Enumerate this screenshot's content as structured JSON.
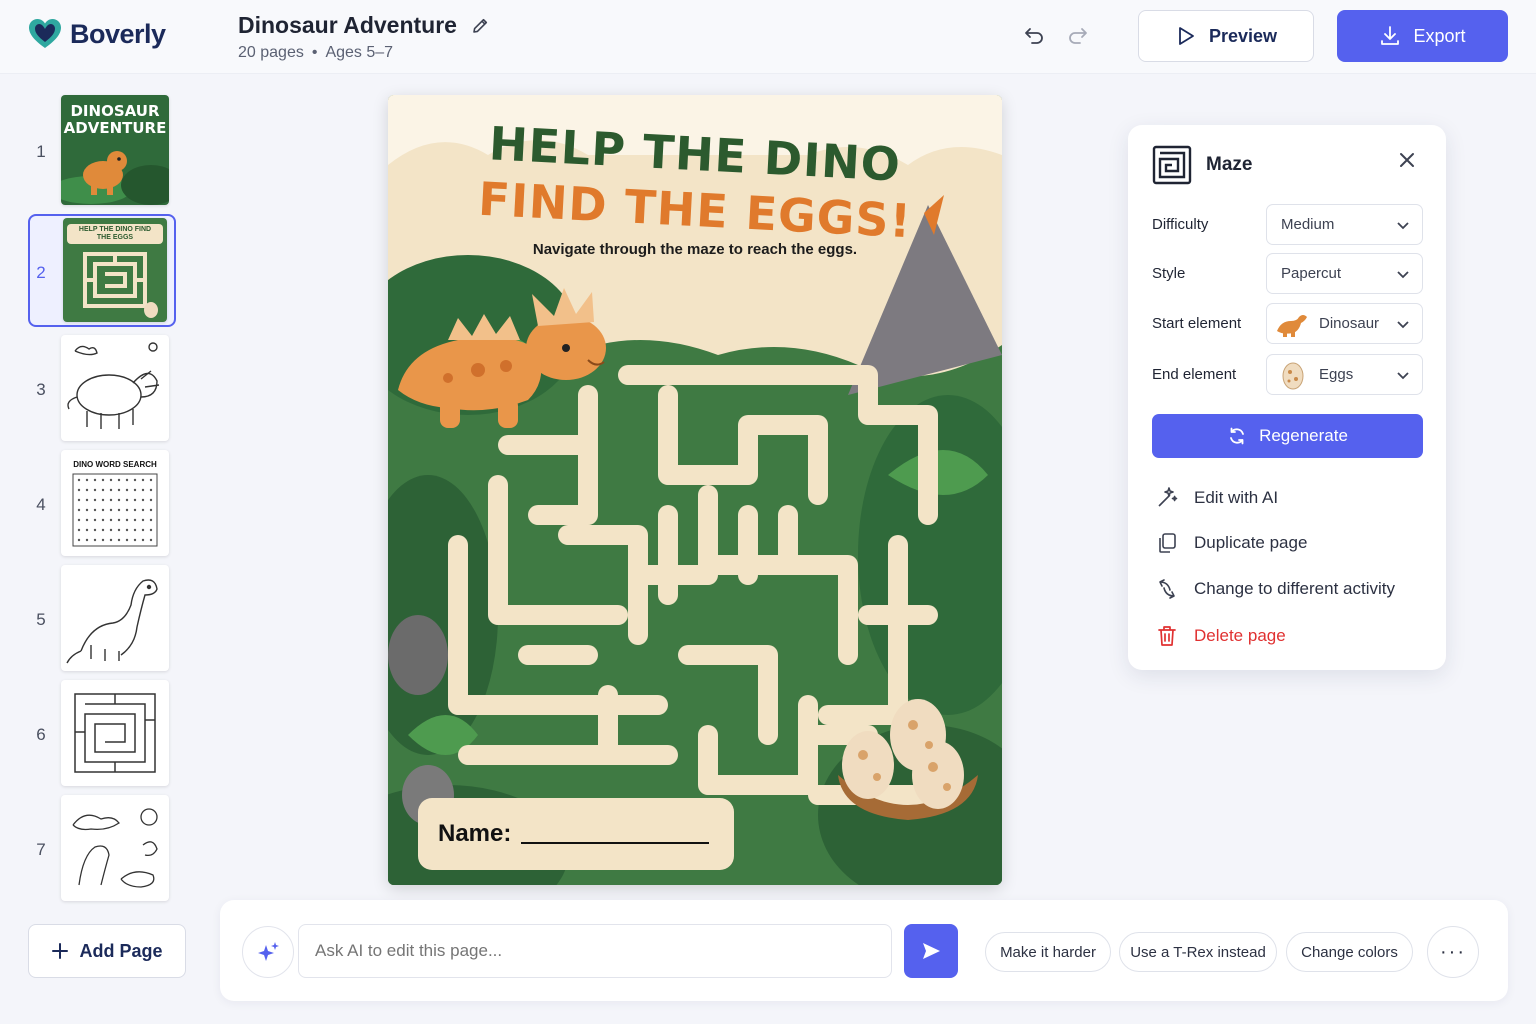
{
  "app": {
    "name": "Boverly"
  },
  "document": {
    "title": "Dinosaur Adventure",
    "pages": "20 pages",
    "separator": "•",
    "ages": "Ages 5–7"
  },
  "toolbar": {
    "preview_label": "Preview",
    "export_label": "Export"
  },
  "sidebar": {
    "pages": [
      {
        "number": "1",
        "thumb_title": "DINOSAUR ADVENTURE"
      },
      {
        "number": "2",
        "thumb_title": "HELP THE DINO FIND THE EGGS"
      },
      {
        "number": "3"
      },
      {
        "number": "4",
        "thumb_title": "DINO WORD SEARCH"
      },
      {
        "number": "5"
      },
      {
        "number": "6"
      },
      {
        "number": "7"
      }
    ],
    "selected_page": "2",
    "add_page_label": "Add Page"
  },
  "canvas": {
    "title_line1": "HELP THE DINO",
    "title_line2": "FIND THE EGGS!",
    "subtitle": "Navigate through the maze to reach the eggs.",
    "name_label": "Name:"
  },
  "panel": {
    "title": "Maze",
    "difficulty_label": "Difficulty",
    "difficulty_value": "Medium",
    "style_label": "Style",
    "style_value": "Papercut",
    "start_label": "Start element",
    "start_value": "Dinosaur",
    "end_label": "End element",
    "end_value": "Eggs",
    "regenerate_label": "Regenerate",
    "actions": [
      "Edit with AI",
      "Duplicate page",
      "Change to different activity",
      "Delete page"
    ]
  },
  "chat": {
    "placeholder": "Ask AI to edit this page...",
    "suggestions": [
      "Make it harder",
      "Use a T-Rex instead",
      "Change colors"
    ],
    "more_label": "···"
  },
  "colors": {
    "accent": "#5561ee",
    "danger": "#e03131",
    "brand_dark": "#1b2a5a"
  }
}
